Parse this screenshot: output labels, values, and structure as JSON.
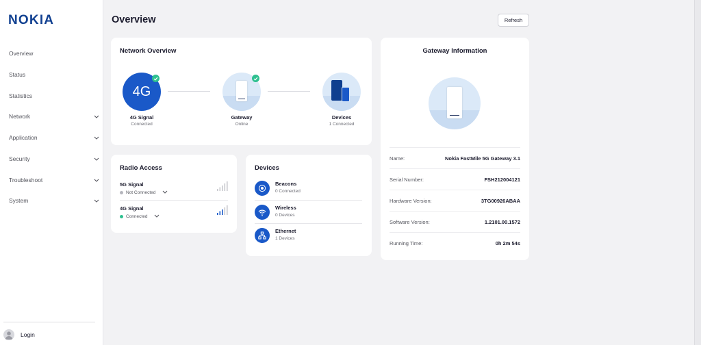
{
  "brand": {
    "logo": "NOKIA",
    "color": "#124191"
  },
  "sidebar": {
    "items": [
      {
        "label": "Overview",
        "expandable": false
      },
      {
        "label": "Status",
        "expandable": false
      },
      {
        "label": "Statistics",
        "expandable": false
      },
      {
        "label": "Network",
        "expandable": true
      },
      {
        "label": "Application",
        "expandable": true
      },
      {
        "label": "Security",
        "expandable": true
      },
      {
        "label": "Troubleshoot",
        "expandable": true
      },
      {
        "label": "System",
        "expandable": true
      }
    ],
    "login_label": "Login"
  },
  "header": {
    "title": "Overview",
    "refresh_label": "Refresh"
  },
  "network_overview": {
    "title": "Network Overview",
    "signal": {
      "label": "4G Signal",
      "status": "Connected",
      "badge": "4G"
    },
    "gateway": {
      "label": "Gateway",
      "status": "Online"
    },
    "devices": {
      "label": "Devices",
      "status": "1 Connected"
    }
  },
  "radio_access": {
    "title": "Radio Access",
    "items": [
      {
        "name": "5G Signal",
        "status": "Not Connected",
        "status_color": "#b5b6bd",
        "bars_active": 0
      },
      {
        "name": "4G Signal",
        "status": "Connected",
        "status_color": "#2ec08f",
        "bars_active": 3
      }
    ]
  },
  "devices_card": {
    "title": "Devices",
    "items": [
      {
        "name": "Beacons",
        "count": "0 Connected",
        "icon": "beacon-icon"
      },
      {
        "name": "Wireless",
        "count": "0 Devices",
        "icon": "wifi-icon"
      },
      {
        "name": "Ethernet",
        "count": "1 Devices",
        "icon": "ethernet-icon"
      }
    ]
  },
  "gateway_info": {
    "title": "Gateway Information",
    "rows": [
      {
        "key": "Name:",
        "value": "Nokia FastMile 5G Gateway 3.1"
      },
      {
        "key": "Serial Number:",
        "value": "FSH212004121"
      },
      {
        "key": "Hardware Version:",
        "value": "3TG00926ABAA"
      },
      {
        "key": "Software Version:",
        "value": "1.2101.00.1572"
      },
      {
        "key": "Running Time:",
        "value": "0h 2m 54s"
      }
    ]
  },
  "colors": {
    "accent": "#1a59c8",
    "success": "#2ec08f",
    "light_blue": "#dbe9f8"
  }
}
